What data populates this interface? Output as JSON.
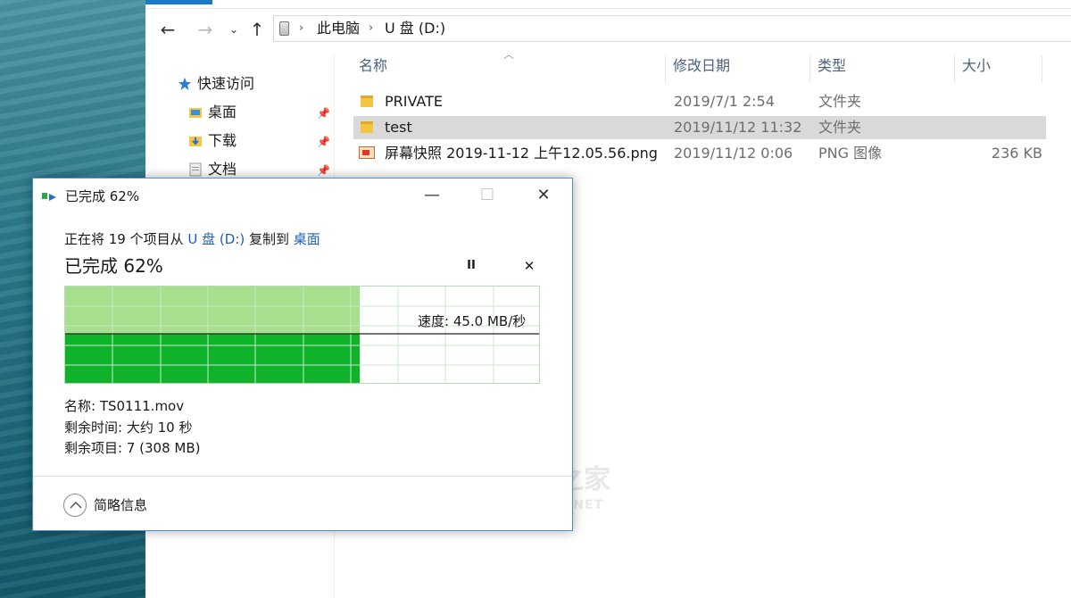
{
  "explorer": {
    "nav": {
      "back": "←",
      "forward": "→",
      "recent": "⌄",
      "up": "↑"
    },
    "address": {
      "crumbs": [
        "此电脑",
        "U 盘 (D:)"
      ],
      "separator": "›"
    },
    "quick_access": {
      "header": "快速访问",
      "items": [
        {
          "label": "桌面",
          "icon": "desktop-folder-icon"
        },
        {
          "label": "下载",
          "icon": "download-folder-icon"
        },
        {
          "label": "文档",
          "icon": "documents-folder-icon"
        }
      ]
    },
    "columns": {
      "name": "名称",
      "modified": "修改日期",
      "type": "类型",
      "size": "大小"
    },
    "files": [
      {
        "name": "PRIVATE",
        "modified": "2019/7/1 2:54",
        "type": "文件夹",
        "size": "",
        "icon": "folder-icon",
        "selected": false
      },
      {
        "name": "test",
        "modified": "2019/11/12 11:32",
        "type": "文件夹",
        "size": "",
        "icon": "folder-icon",
        "selected": true
      },
      {
        "name": "屏幕快照 2019-11-12 上午12.05.56.png",
        "modified": "2019/11/12 0:06",
        "type": "PNG 图像",
        "size": "236 KB",
        "icon": "png-image-icon",
        "selected": false
      }
    ]
  },
  "dialog": {
    "title": "已完成 62%",
    "controls": {
      "minimize": "—",
      "maximize": "☐",
      "close": "✕"
    },
    "copy_line": {
      "prefix": "正在将 19 个项目从 ",
      "source": "U 盘 (D:)",
      "middle": " 复制到 ",
      "destination": "桌面"
    },
    "status": "已完成 62%",
    "pause": "II",
    "cancel": "✕",
    "progress_fraction": 0.62,
    "speed": "速度: 45.0 MB/秒",
    "details": {
      "name": "名称: TS0111.mov",
      "time_remaining": "剩余时间: 大约 10 秒",
      "items_remaining": "剩余项目: 7 (308 MB)"
    },
    "fewer_details": "简略信息",
    "colors": {
      "progress_light": "#a6e08e",
      "progress_dark": "#0fb32a",
      "grid": "#c9e8c9",
      "link": "#1e5fb4"
    }
  },
  "watermark": {
    "main": "数码之家",
    "sub": "MYDIGIT.NET"
  }
}
